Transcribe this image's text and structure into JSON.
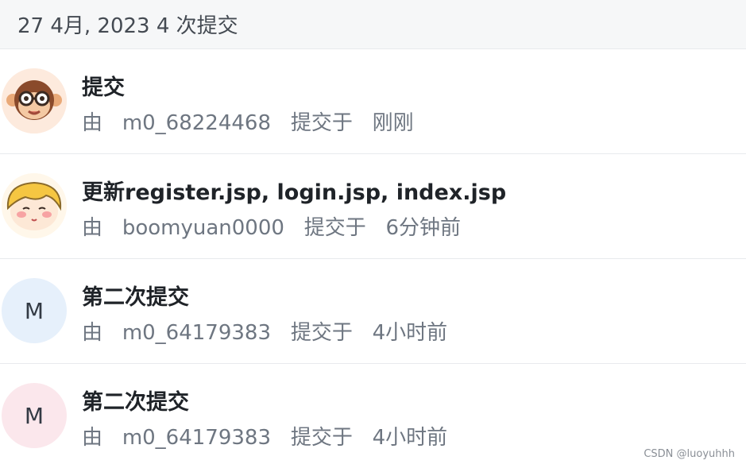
{
  "group_header": {
    "date_text": "27 4月, 2023 4 次提交"
  },
  "commits": [
    {
      "title": "提交",
      "by_prefix": "由",
      "author": "m0_68224468",
      "committed_word": "提交于",
      "time": "刚刚",
      "avatar": {
        "type": "image",
        "icon": "monkey-avatar-icon"
      }
    },
    {
      "title": "更新register.jsp, login.jsp, index.jsp",
      "by_prefix": "由",
      "author": "boomyuan0000",
      "committed_word": "提交于",
      "time": "6分钟前",
      "avatar": {
        "type": "image",
        "icon": "girl-avatar-icon"
      }
    },
    {
      "title": "第二次提交",
      "by_prefix": "由",
      "author": "m0_64179383",
      "committed_word": "提交于",
      "time": "4小时前",
      "avatar": {
        "type": "letter",
        "letter": "M",
        "bg": "#e6f0fb"
      }
    },
    {
      "title": "第二次提交",
      "by_prefix": "由",
      "author": "m0_64179383",
      "committed_word": "提交于",
      "time": "4小时前",
      "avatar": {
        "type": "letter",
        "letter": "M",
        "bg": "#fbe7ec"
      }
    }
  ],
  "watermark": "CSDN @luoyuhhh"
}
